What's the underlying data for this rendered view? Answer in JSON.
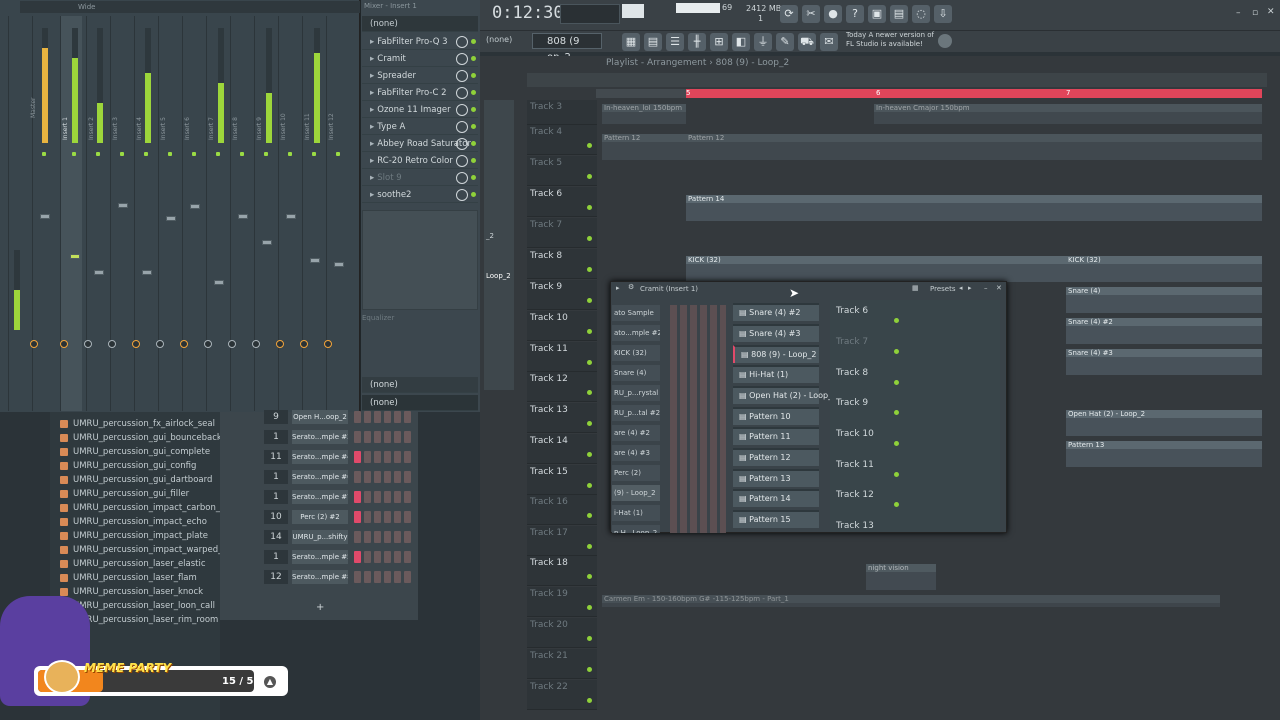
{
  "topbar": {
    "time_main": "0:12:30",
    "cpu": "69",
    "memory": "2412 MB",
    "cpu_sub": "1",
    "pattern_selector": "808 (9 op_2",
    "none_label": "(none)",
    "news_line1": "Today  A newer version of",
    "news_line2": "FL Studio is available!"
  },
  "mixer": {
    "title": "Wide",
    "insert_title": "Mixer - Insert 1",
    "strip_labels": [
      "Master",
      "Insert 1",
      "Insert 2",
      "Insert 3",
      "Insert 4",
      "Insert 5",
      "Insert 6",
      "Insert 7",
      "Insert 8",
      "Insert 9",
      "Insert 10",
      "Insert 11",
      "Insert 12"
    ]
  },
  "insert_panel": {
    "top_slot": "(none)",
    "slots": [
      "FabFilter Pro-Q 3",
      "Cramit",
      "Spreader",
      "FabFilter Pro-C 2",
      "Ozone 11 Imager",
      "Type A",
      "Abbey Road Saturator",
      "RC-20 Retro Color",
      "Slot 9",
      "soothe2"
    ],
    "equalizer_label": "Equalizer",
    "bottom_slot1": "(none)",
    "bottom_slot2": "(none)"
  },
  "browser": {
    "items": [
      "UMRU_percussion_fx_airlock_seal",
      "UMRU_percussion_gui_bounceback",
      "UMRU_percussion_gui_complete",
      "UMRU_percussion_gui_config",
      "UMRU_percussion_gui_dartboard",
      "UMRU_percussion_gui_filler",
      "UMRU_percussion_impact_carbon_punch",
      "UMRU_percussion_impact_echo",
      "UMRU_percussion_impact_plate",
      "UMRU_percussion_impact_warped_plate",
      "UMRU_percussion_laser_elastic",
      "UMRU_percussion_laser_flam",
      "UMRU_percussion_laser_knock",
      "UMRU_percussion_laser_loon_call",
      "UMRU_percussion_laser_rim_room"
    ]
  },
  "channel_rack": {
    "rows": [
      {
        "num": "9",
        "name": "Open H...oop_2"
      },
      {
        "num": "1",
        "name": "Serato...mple #3"
      },
      {
        "num": "11",
        "name": "Serato...mple #4"
      },
      {
        "num": "1",
        "name": "Serato...mple #6"
      },
      {
        "num": "1",
        "name": "Serato...mple #7"
      },
      {
        "num": "10",
        "name": "Perc (2) #2"
      },
      {
        "num": "14",
        "name": "UMRU_p...shifty"
      },
      {
        "num": "1",
        "name": "Serato...mple #5"
      },
      {
        "num": "12",
        "name": "Serato...mple #8"
      }
    ],
    "add_label": "+"
  },
  "playlist": {
    "title": "Playlist - Arrangement › 808 (9) - Loop_2",
    "ruler": [
      "5",
      "6",
      "7"
    ],
    "tracks": [
      "Track 3",
      "Track 4",
      "Track 5",
      "Track 6",
      "Track 7",
      "Track 8",
      "Track 9",
      "Track 10",
      "Track 11",
      "Track 12",
      "Track 13",
      "Track 14",
      "Track 15",
      "Track 16",
      "Track 17",
      "Track 18",
      "Track 19",
      "Track 20",
      "Track 21",
      "Track 22"
    ],
    "clips": {
      "in_heaven_a": "In-heaven_loI 150bpm",
      "in_heaven_b": "In-heaven Cmajor 150bpm",
      "pattern12a": "Pattern 12",
      "pattern12b": "Pattern 12",
      "pattern14": "Pattern 14",
      "kick_a": "KICK (32)",
      "kick_b": "KICK (32)",
      "snare4": "Snare (4)",
      "snare4_2": "Snare (4) #2",
      "snare4_3": "Snare (4) #3",
      "openhat": "Open Hat (2) - Loop_2",
      "pattern13": "Pattern 13",
      "night_vision": "night vision",
      "carmen": "Carmen Em - 150-160bpm G#  -115-125bpm - Part_1",
      "loop2_side": "Loop_2",
      "p2_side": "_2"
    }
  },
  "cramit": {
    "title": "Cramit (Insert 1)",
    "presets_label": "Presets",
    "channels": [
      "ato Sample",
      "ato...mple #2",
      "KICK (32)",
      "Snare (4)",
      "RU_p...rystal",
      "RU_p...tal #2",
      "are (4) #2",
      "are (4) #3",
      "Perc (2)",
      "(9) - Loop_2",
      "i-Hat (1)",
      "n H...Loop_2"
    ],
    "patterns": [
      "Snare (4) #2",
      "Snare (4) #3",
      "808 (9) - Loop_2",
      "Hi-Hat (1)",
      "Open Hat (2) - Loop_2",
      "Pattern 10",
      "Pattern 11",
      "Pattern 12",
      "Pattern 13",
      "Pattern 14",
      "Pattern 15"
    ],
    "tracks": [
      "Track 6",
      "Track 7",
      "Track 8",
      "Track 9",
      "Track 10",
      "Track 11",
      "Track 12",
      "Track 13"
    ]
  },
  "overlay": {
    "title": "MEME PARTY",
    "count": "15 / 50",
    "progress_fraction": 0.3
  }
}
